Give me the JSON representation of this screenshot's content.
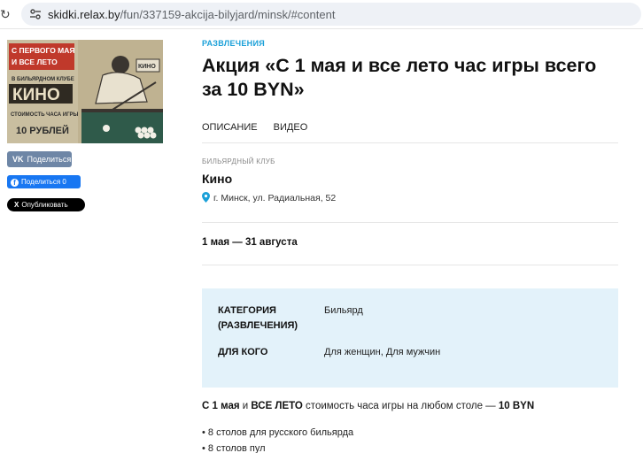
{
  "browser": {
    "url_host": "skidki.relax.by",
    "url_path": "/fun/337159-akcija-bilyjard/minsk/#content"
  },
  "hero": {
    "line1": "С ПЕРВОГО МАЯ",
    "line2": "И ВСЕ ЛЕТО",
    "line3": "В БИЛЬЯРДНОМ КЛУБЕ",
    "club": "КИНО",
    "line4": "СТОИМОСТЬ ЧАСА ИГРЫ",
    "price": "10 РУБЛЕЙ",
    "sign": "КИНО"
  },
  "share": {
    "vk_logo": "VK",
    "vk_label": "Поделиться",
    "fb_logo": "f",
    "fb_label": "Поделиться 0",
    "x_logo": "X",
    "x_label": "Опубликовать"
  },
  "main": {
    "category": "РАЗВЛЕЧЕНИЯ",
    "title": "Акция «С 1 мая и все лето час игры всего за 10 BYN»",
    "tabs": [
      "ОПИСАНИЕ",
      "ВИДЕО"
    ],
    "place_type": "БИЛЬЯРДНЫЙ КЛУБ",
    "place_name": "Кино",
    "address": "г. Минск, ул. Радиальная, 52",
    "dates": "1 мая — 31 августа"
  },
  "info": {
    "category_key": "КАТЕГОРИЯ (РАЗВЛЕЧЕНИЯ)",
    "category_val": "Бильярд",
    "audience_key": "ДЛЯ КОГО",
    "audience_val": "Для женщин, Для мужчин"
  },
  "description": {
    "part1": "С 1 мая",
    "part2": " и ",
    "part3": "ВСЕ ЛЕТО",
    "part4": " стоимость часа игры на любом столе — ",
    "part5": "10 BYN",
    "bullets": [
      "• 8 столов для русского бильярда",
      "• 8 столов пул"
    ]
  },
  "colors": {
    "accent": "#1aa0d8",
    "info_bg": "#e3f2fa",
    "vk": "#6e86a6",
    "fb": "#1877f2"
  },
  "icons": {
    "reload": "reload-icon",
    "site_settings": "tune-icon",
    "location": "pin-icon"
  }
}
